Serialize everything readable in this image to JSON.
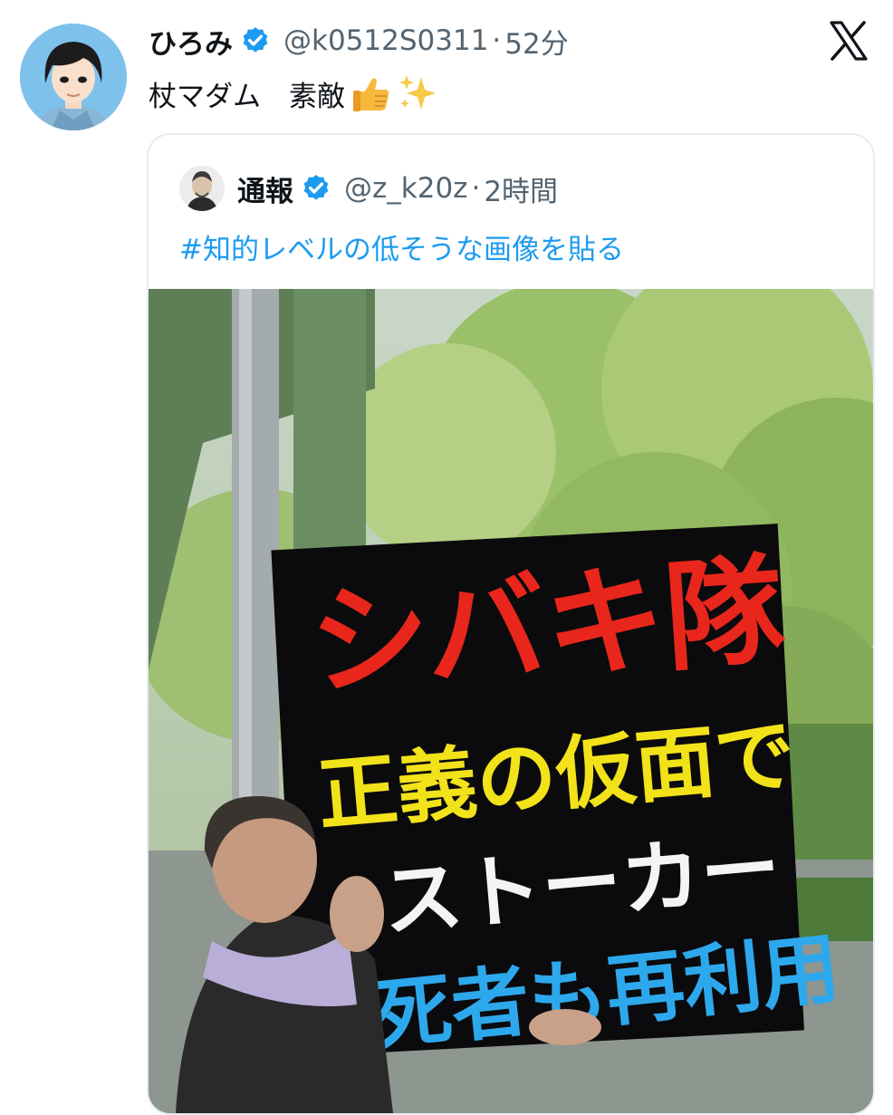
{
  "tweet": {
    "author": {
      "display_name": "ひろみ",
      "handle": "@k0512S0311",
      "time": "52分"
    },
    "separator": "·",
    "text": "杖マダム　素敵",
    "emojis": [
      "thumbs-up",
      "sparkles"
    ]
  },
  "quoted_tweet": {
    "author": {
      "display_name": "通報",
      "handle": "@z_k20z",
      "time": "2時間"
    },
    "separator": "·",
    "text": "#知的レベルの低そうな画像を貼る",
    "photo": {
      "sign_lines": [
        "シバキ隊",
        "正義の仮面で",
        "ストーカー",
        "死者も再利用"
      ],
      "sign_colors": [
        "#e8261c",
        "#f2e21a",
        "#f4f4f4",
        "#2ea8ec"
      ]
    }
  },
  "colors": {
    "verified": "#1d9bf0",
    "link": "#1d9bf0",
    "secondary_text": "#536471",
    "avatar_bg": "#7ec2ec"
  },
  "icons": {
    "verified": "verified-badge-icon",
    "platform": "x-logo-icon"
  }
}
